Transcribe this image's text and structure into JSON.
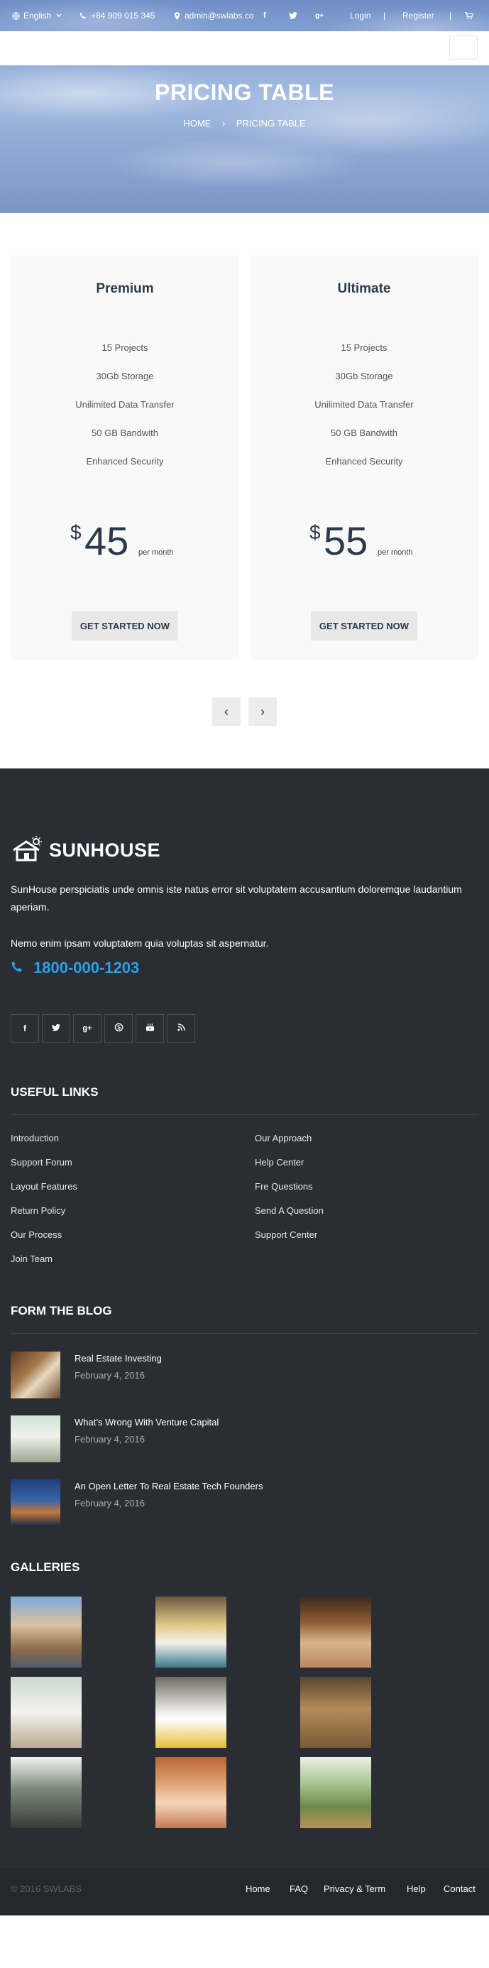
{
  "topbar": {
    "language": "English",
    "phone": "+84 909 015 345",
    "email": "admin@swlabs.co",
    "login": "Login",
    "register": "Register",
    "separator": "|"
  },
  "hero": {
    "title": "PRICING TABLE",
    "breadcrumb_home": "HOME",
    "breadcrumb_sep": "›",
    "breadcrumb_current": "PRICING TABLE"
  },
  "pricing": {
    "currency": "$",
    "plans": [
      {
        "name": "Premium",
        "features": [
          "15 Projects",
          "30Gb Storage",
          "Unilimited Data Transfer",
          "50 GB Bandwith",
          "Enhanced Security"
        ],
        "price": "45",
        "period": "per month",
        "cta": "GET STARTED NOW"
      },
      {
        "name": "Ultimate",
        "features": [
          "15 Projects",
          "30Gb Storage",
          "Unilimited Data Transfer",
          "50 GB Bandwith",
          "Enhanced Security"
        ],
        "price": "55",
        "period": "per month",
        "cta": "GET STARTED NOW"
      }
    ],
    "prev": "‹",
    "next": "›"
  },
  "footer": {
    "brand": "SUNHOUSE",
    "about": "SunHouse perspiciatis unde omnis iste natus error sit voluptatem accusantium doloremque laudantium aperiam.",
    "about2": "Nemo enim ipsam voluptatem quia voluptas sit aspernatur.",
    "phone": "1800-000-1203",
    "socials": [
      "facebook-icon",
      "twitter-icon",
      "google-plus-icon",
      "skype-icon",
      "youtube-icon",
      "rss-icon"
    ],
    "useful_links_title": "USEFUL LINKS",
    "useful_links_left": [
      "Introduction",
      "Support Forum",
      "Layout Features",
      "Return Policy",
      "Our Process",
      "Join Team"
    ],
    "useful_links_right": [
      "Our Approach",
      "Help Center",
      "Fre Questions",
      "Send A Question",
      "Support Center"
    ],
    "blog_title": "FORM THE BLOG",
    "blog_posts": [
      {
        "title": "Real Estate Investing",
        "date": "February 4, 2016"
      },
      {
        "title": "What’s Wrong With Venture Capital",
        "date": "February 4, 2016"
      },
      {
        "title": "An Open Letter To Real Estate Tech Founders",
        "date": "February 4, 2016"
      }
    ],
    "galleries_title": "GALLERIES",
    "copyright": "© 2016 SWLABS",
    "bottom_links": [
      "Home",
      "FAQ",
      "Privacy & Term",
      "Help",
      "Contact"
    ]
  }
}
